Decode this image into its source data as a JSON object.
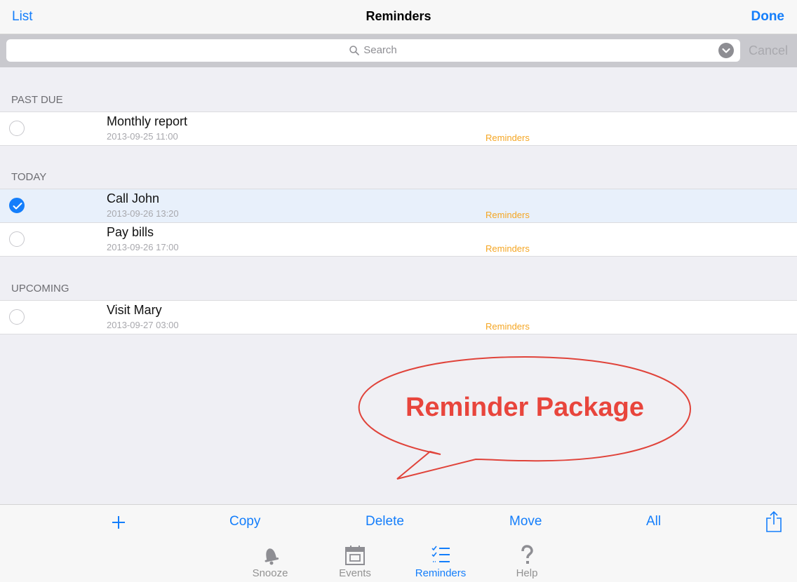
{
  "navbar": {
    "left_label": "List",
    "title": "Reminders",
    "right_label": "Done"
  },
  "search": {
    "placeholder": "Search",
    "cancel_label": "Cancel"
  },
  "sections": [
    {
      "header": "PAST DUE",
      "items": [
        {
          "title": "Monthly report",
          "date": "2013-09-25 11:00",
          "list": "Reminders",
          "checked": false
        }
      ]
    },
    {
      "header": "TODAY",
      "items": [
        {
          "title": "Call John",
          "date": "2013-09-26 13:20",
          "list": "Reminders",
          "checked": true
        },
        {
          "title": "Pay bills",
          "date": "2013-09-26 17:00",
          "list": "Reminders",
          "checked": false
        }
      ]
    },
    {
      "header": "UPCOMING",
      "items": [
        {
          "title": "Visit Mary",
          "date": "2013-09-27 03:00",
          "list": "Reminders",
          "checked": false
        }
      ]
    }
  ],
  "annotation": {
    "text": "Reminder Package",
    "color": "#e8453c"
  },
  "toolbar": {
    "add_icon": "plus-icon",
    "copy_label": "Copy",
    "delete_label": "Delete",
    "move_label": "Move",
    "all_label": "All",
    "share_icon": "share-icon"
  },
  "tabs": [
    {
      "label": "Snooze",
      "icon": "bell-icon",
      "active": false
    },
    {
      "label": "Events",
      "icon": "calendar-icon",
      "active": false
    },
    {
      "label": "Reminders",
      "icon": "checklist-icon",
      "active": true
    },
    {
      "label": "Help",
      "icon": "question-icon",
      "active": false
    }
  ],
  "colors": {
    "accent": "#147efb",
    "list_tag": "#f5a623",
    "selected_row": "#e8f0fb"
  }
}
